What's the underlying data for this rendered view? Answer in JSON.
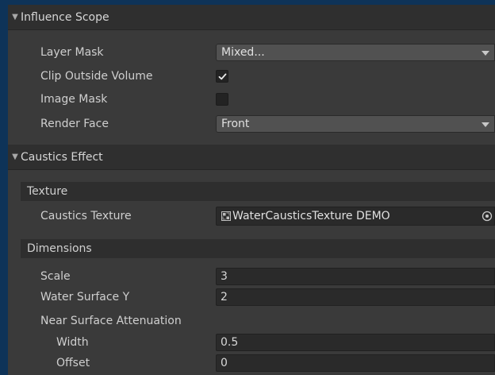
{
  "influence": {
    "title": "Influence Scope",
    "layer_mask": {
      "label": "Layer Mask",
      "value": "Mixed..."
    },
    "clip_outside": {
      "label": "Clip Outside Volume",
      "checked": true
    },
    "image_mask": {
      "label": "Image Mask",
      "checked": false
    },
    "render_face": {
      "label": "Render Face",
      "value": "Front"
    }
  },
  "caustics": {
    "title": "Caustics Effect",
    "texture_header": "Texture",
    "caustics_texture": {
      "label": "Caustics Texture",
      "value": "WaterCausticsTexture DEMO"
    },
    "dimensions_header": "Dimensions",
    "scale": {
      "label": "Scale",
      "value": "3"
    },
    "water_surface_y": {
      "label": "Water Surface Y",
      "value": "2"
    },
    "near_surface": {
      "label": "Near Surface Attenuation"
    },
    "width": {
      "label": "Width",
      "value": "0.5"
    },
    "offset": {
      "label": "Offset",
      "value": "0"
    }
  },
  "icons": [
    "foldout-arrow-icon",
    "checkmark-icon",
    "texture-icon",
    "object-picker-icon",
    "dropdown-caret-icon"
  ],
  "colors": {
    "background": "#0e3358",
    "panel": "#3a3a3a",
    "field": "#2a2a2a",
    "dropdown": "#515151"
  }
}
